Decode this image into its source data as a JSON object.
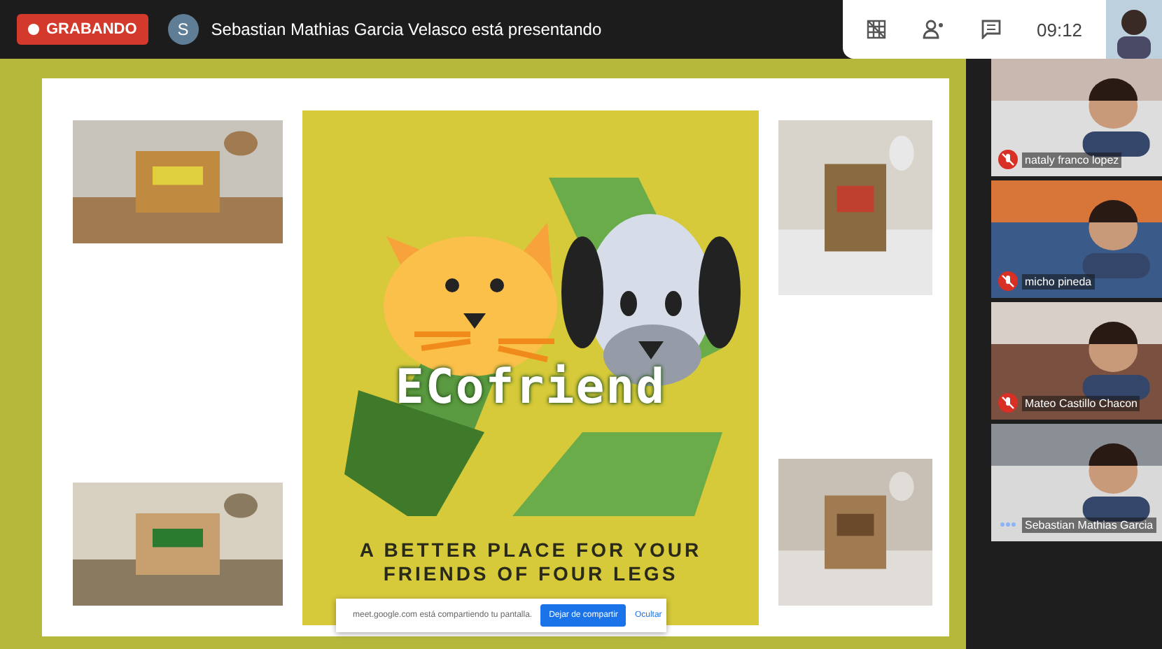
{
  "recording": {
    "label": "GRABANDO"
  },
  "presenter": {
    "initial": "S",
    "text": "Sebastian Mathias Garcia Velasco está presentando"
  },
  "time": "09:12",
  "slide": {
    "logo": "ECofriend",
    "tagline": [
      "A BETTER PLACE FOR YOUR",
      "FRIENDS OF FOUR LEGS"
    ]
  },
  "share_bar": {
    "message": "meet.google.com está compartiendo tu pantalla.",
    "stop_button": "Dejar de compartir",
    "hide_link": "Ocultar"
  },
  "participants": [
    {
      "name": "nataly franco lopez",
      "muted": true
    },
    {
      "name": "micho pineda",
      "muted": true
    },
    {
      "name": "Mateo Castillo Chacon",
      "muted": true
    },
    {
      "name": "Sebastian Mathias Garcia",
      "muted": false
    }
  ]
}
